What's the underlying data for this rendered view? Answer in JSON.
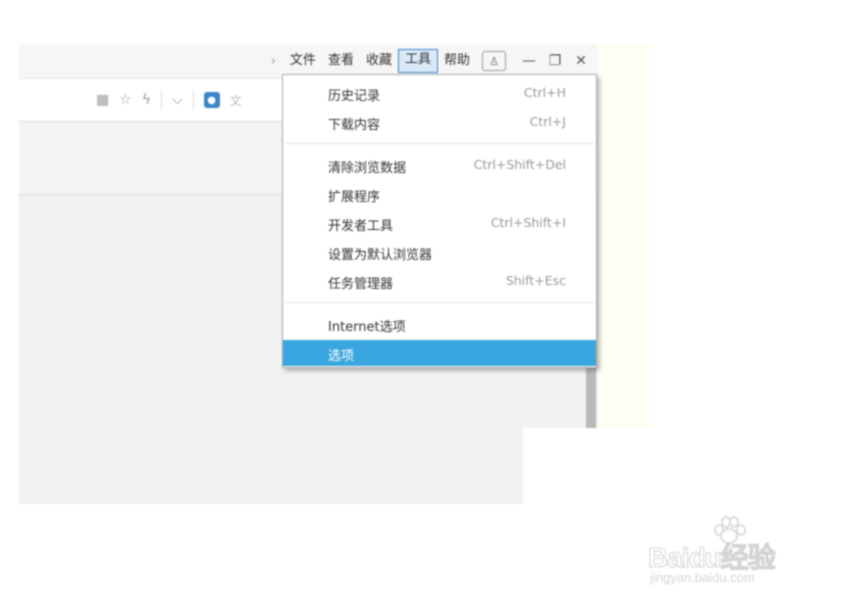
{
  "toolbar": {
    "menus": [
      "文件",
      "查看",
      "收藏",
      "工具",
      "帮助"
    ],
    "active_menu": "工具",
    "minimize": "—",
    "restore": "❐",
    "close": "✕"
  },
  "address_bar": {
    "search_text": "文"
  },
  "tools_menu": {
    "groups": [
      [
        {
          "label": "历史记录",
          "shortcut": "Ctrl+H"
        },
        {
          "label": "下载内容",
          "shortcut": "Ctrl+J"
        }
      ],
      [
        {
          "label": "清除浏览数据",
          "shortcut": "Ctrl+Shift+Del"
        },
        {
          "label": "扩展程序",
          "shortcut": ""
        },
        {
          "label": "开发者工具",
          "shortcut": "Ctrl+Shift+I"
        },
        {
          "label": "设置为默认浏览器",
          "shortcut": ""
        },
        {
          "label": "任务管理器",
          "shortcut": "Shift+Esc"
        }
      ],
      [
        {
          "label": "Internet选项",
          "shortcut": ""
        },
        {
          "label": "选项",
          "shortcut": "",
          "selected": true
        }
      ]
    ]
  },
  "watermark": {
    "brand": "Baidu经验",
    "url": "jingyan.baidu.com"
  },
  "colors": {
    "selection": "#3aa6df",
    "active_menu_border": "#3a86c8"
  }
}
